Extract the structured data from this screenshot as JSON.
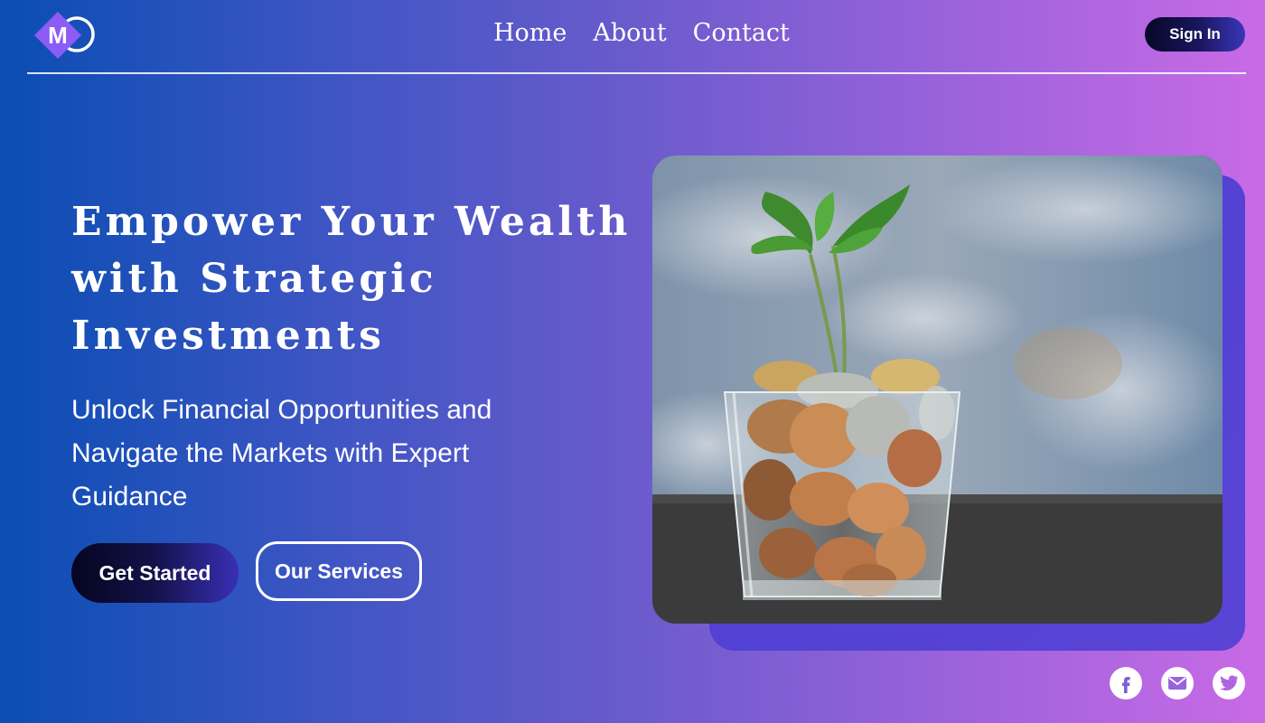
{
  "brand": {
    "logo_letter": "M",
    "logo_icon": "m-logo-icon",
    "accent_color": "#8b5cf6"
  },
  "nav": {
    "items": [
      {
        "label": "Home"
      },
      {
        "label": "About"
      },
      {
        "label": "Contact"
      }
    ]
  },
  "header": {
    "sign_in_label": "Sign In"
  },
  "hero": {
    "title": "Empower Your Wealth with Strategic Investments",
    "subtitle": "Unlock Financial Opportunities and Navigate the Markets with Expert Guidance",
    "primary_button": "Get Started",
    "secondary_button": "Our Services",
    "image_subject": "plant-growing-from-coin-jar"
  },
  "social": {
    "icons": [
      "facebook-icon",
      "email-icon",
      "twitter-icon"
    ],
    "icon_color": "#ffffff"
  },
  "colors": {
    "gradient_start": "#0a4db3",
    "gradient_end": "#c96ae6",
    "dark_button": "#070726",
    "image_shadow": "#4b3fd0"
  }
}
